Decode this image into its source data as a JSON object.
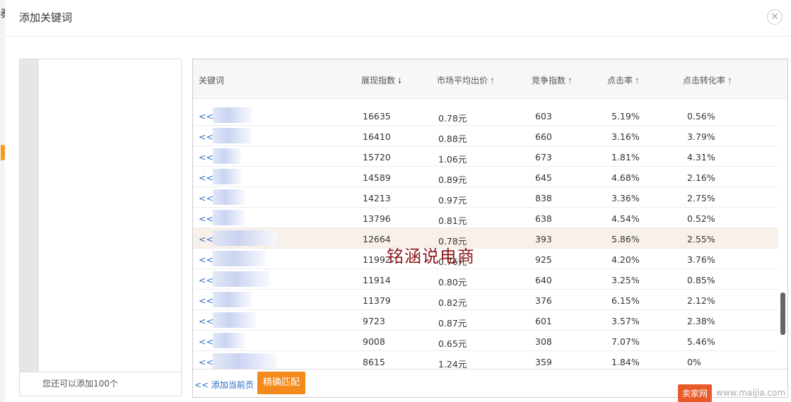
{
  "dialog": {
    "title": "添加关键词",
    "close_icon": "close-icon"
  },
  "left_panel": {
    "footer_text": "您还可以添加100个"
  },
  "table": {
    "columns": {
      "keyword": "关键词",
      "show_index": "展现指数",
      "avg_price": "市场平均出价",
      "competition": "竞争指数",
      "ctr": "点击率",
      "conversion": "点击转化率"
    },
    "sort": {
      "active_column": "show_index",
      "active_direction": "down",
      "active_color": "#1f6fc5"
    },
    "add_icon": "<<",
    "rows": [
      {
        "show": "16635",
        "price": "0.78元",
        "comp": "603",
        "ctr": "5.19%",
        "conv": "0.56%"
      },
      {
        "show": "16410",
        "price": "0.88元",
        "comp": "660",
        "ctr": "3.16%",
        "conv": "3.79%"
      },
      {
        "show": "15720",
        "price": "1.06元",
        "comp": "673",
        "ctr": "1.81%",
        "conv": "4.31%"
      },
      {
        "show": "14589",
        "price": "0.89元",
        "comp": "645",
        "ctr": "4.68%",
        "conv": "2.16%"
      },
      {
        "show": "14213",
        "price": "0.97元",
        "comp": "838",
        "ctr": "3.36%",
        "conv": "2.75%"
      },
      {
        "show": "13796",
        "price": "0.81元",
        "comp": "638",
        "ctr": "4.54%",
        "conv": "0.52%"
      },
      {
        "show": "12664",
        "price": "0.78元",
        "comp": "393",
        "ctr": "5.86%",
        "conv": "2.55%",
        "highlight": true
      },
      {
        "show": "11992",
        "price": "0.76元",
        "comp": "925",
        "ctr": "4.20%",
        "conv": "3.76%"
      },
      {
        "show": "11914",
        "price": "0.80元",
        "comp": "640",
        "ctr": "3.25%",
        "conv": "0.85%"
      },
      {
        "show": "11379",
        "price": "0.82元",
        "comp": "376",
        "ctr": "6.15%",
        "conv": "2.12%"
      },
      {
        "show": "9723",
        "price": "0.87元",
        "comp": "601",
        "ctr": "3.57%",
        "conv": "2.38%"
      },
      {
        "show": "9008",
        "price": "0.65元",
        "comp": "308",
        "ctr": "7.07%",
        "conv": "5.46%"
      },
      {
        "show": "8615",
        "price": "1.24元",
        "comp": "359",
        "ctr": "1.84%",
        "conv": "0%"
      }
    ]
  },
  "footer": {
    "add_page_label": "<<  添加当前页",
    "exact_match_label": "精确匹配",
    "accent_color": "#f48a1c"
  },
  "watermark": {
    "text": "铭涵说电商",
    "badge_brand": "卖家网",
    "badge_url": "www.maijia.com"
  }
}
